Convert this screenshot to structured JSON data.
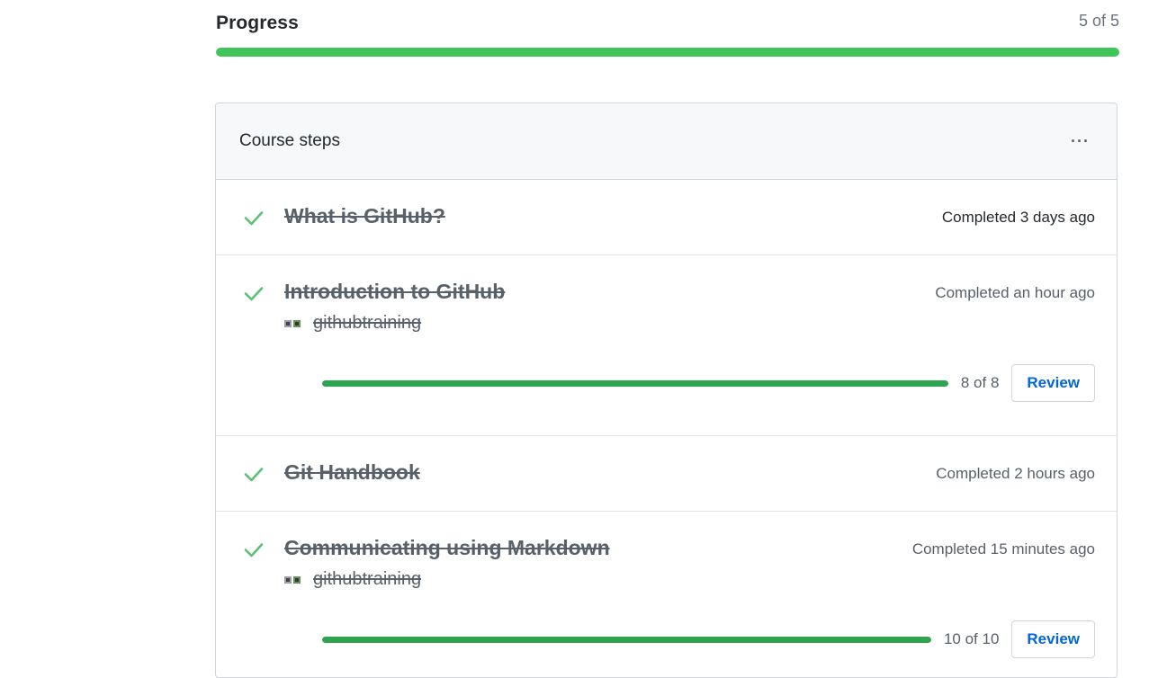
{
  "progress": {
    "title": "Progress",
    "count_label": "5 of 5",
    "fraction": 1.0,
    "color": "#3fc55a"
  },
  "course_steps": {
    "title": "Course steps",
    "more_label": "···",
    "steps": [
      {
        "name": "What is GitHub?",
        "status": "Completed 3 days ago",
        "icon": "check-icon"
      },
      {
        "name": "Introduction to GitHub",
        "status": "Completed an hour ago",
        "org": "githubtraining",
        "progress_label": "8 of 8",
        "progress_fraction": 1.0,
        "button_label": "Review",
        "icon": "check-icon"
      },
      {
        "name": "Git Handbook",
        "status": "Completed 2 hours ago",
        "icon": "check-icon"
      },
      {
        "name": "Communicating using Markdown",
        "status": "Completed 15 minutes ago",
        "org": "githubtraining",
        "progress_label": "10 of 10",
        "progress_fraction": 1.0,
        "button_label": "Review",
        "icon": "check-icon"
      }
    ]
  },
  "colors": {
    "check": "#5cc177",
    "progress_fill": "#2ea44f",
    "link": "#0366d6"
  }
}
